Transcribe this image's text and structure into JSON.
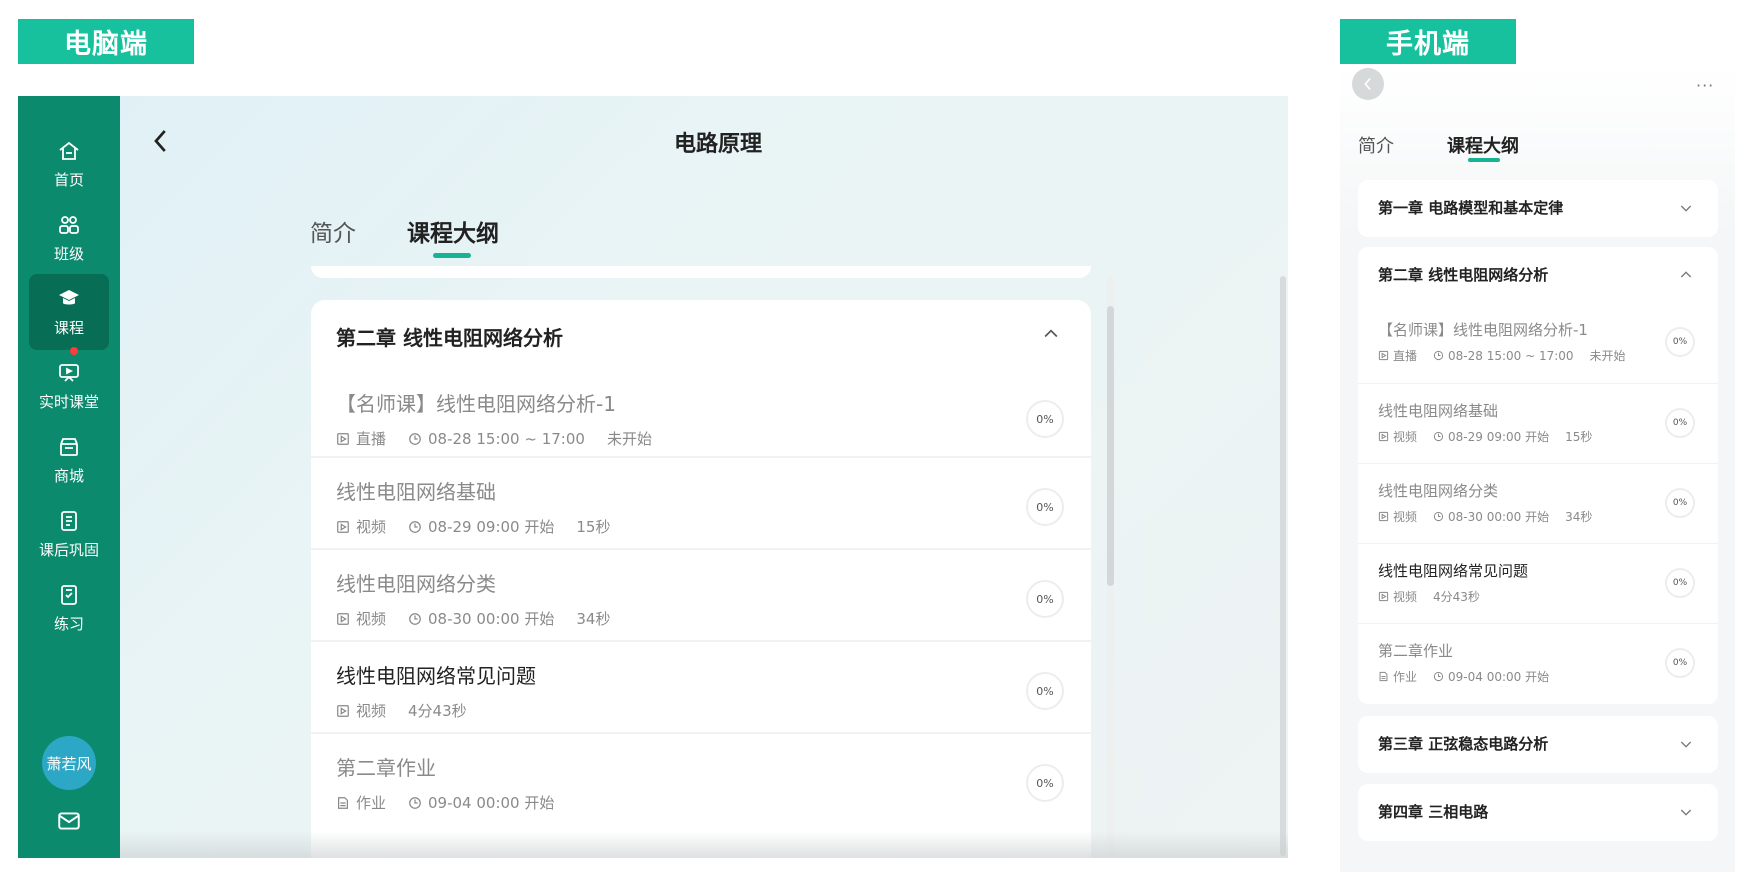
{
  "labels": {
    "pc": "电脑端",
    "mobile": "手机端"
  },
  "pc": {
    "sidebar": {
      "items": [
        {
          "label": "首页",
          "icon": "home-icon"
        },
        {
          "label": "班级",
          "icon": "class-icon"
        },
        {
          "label": "课程",
          "icon": "course-icon",
          "active": true
        },
        {
          "label": "实时课堂",
          "icon": "live-classroom-icon",
          "badge": "red-dot"
        },
        {
          "label": "商城",
          "icon": "store-icon"
        },
        {
          "label": "课后巩固",
          "icon": "review-icon"
        },
        {
          "label": "练习",
          "icon": "practice-icon"
        }
      ],
      "avatar": "萧若风",
      "mail_icon": "mail-icon"
    },
    "title": "电路原理",
    "tabs": [
      "简介",
      "课程大纲"
    ],
    "chapter": {
      "title": "第二章 线性电阻网络分析",
      "lessons": [
        {
          "title": "【名师课】线性电阻网络分析-1",
          "type": "直播",
          "time": "08-28 15:00 ~ 17:00",
          "extra": "未开始",
          "progress": "0%"
        },
        {
          "title": "线性电阻网络基础",
          "type": "视频",
          "time": "08-29 09:00 开始",
          "extra": "15秒",
          "progress": "0%"
        },
        {
          "title": "线性电阻网络分类",
          "type": "视频",
          "time": "08-30 00:00 开始",
          "extra": "34秒",
          "progress": "0%"
        },
        {
          "title": "线性电阻网络常见问题",
          "type": "视频",
          "time": "4分43秒",
          "progress": "0%"
        },
        {
          "title": "第二章作业",
          "type": "作业",
          "time": "09-04 00:00 开始",
          "progress": "0%"
        }
      ]
    }
  },
  "mobile": {
    "more": "···",
    "tabs": [
      "简介",
      "课程大纲"
    ],
    "chapters": [
      {
        "title": "第一章 电路模型和基本定律"
      },
      {
        "title": "第二章 线性电阻网络分析",
        "lessons": [
          {
            "title": "【名师课】线性电阻网络分析-1",
            "type": "直播",
            "time": "08-28 15:00 ~ 17:00",
            "extra": "未开始",
            "progress": "0%"
          },
          {
            "title": "线性电阻网络基础",
            "type": "视频",
            "time": "08-29 09:00 开始",
            "extra": "15秒",
            "progress": "0%"
          },
          {
            "title": "线性电阻网络分类",
            "type": "视频",
            "time": "08-30 00:00 开始",
            "extra": "34秒",
            "progress": "0%"
          },
          {
            "title": "线性电阻网络常见问题",
            "type": "视频",
            "time": "4分43秒",
            "progress": "0%"
          },
          {
            "title": "第二章作业",
            "type": "作业",
            "time": "09-04 00:00 开始",
            "progress": "0%"
          }
        ]
      },
      {
        "title": "第三章 正弦稳态电路分析"
      },
      {
        "title": "第四章 三相电路"
      }
    ]
  },
  "colors": {
    "accent": "#17c19d",
    "sidebar": "#0c8a6d",
    "sidebar_active": "#076d55",
    "avatar": "#2ca7c5"
  }
}
